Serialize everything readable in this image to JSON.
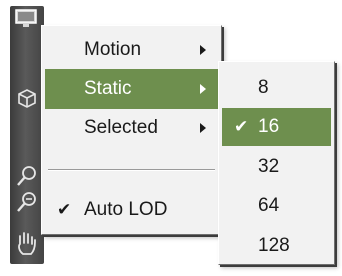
{
  "toolbar": {
    "icons": [
      "monitor-icon",
      "cube-icon",
      "zoom-icon",
      "zoom-out-icon",
      "pan-hand-icon"
    ]
  },
  "main_menu": {
    "items": [
      {
        "label": "Motion",
        "has_submenu": true,
        "checked": false,
        "highlighted": false
      },
      {
        "label": "Static",
        "has_submenu": true,
        "checked": false,
        "highlighted": true
      },
      {
        "label": "Selected",
        "has_submenu": true,
        "checked": false,
        "highlighted": false
      },
      {
        "label": "Auto LOD",
        "has_submenu": false,
        "checked": true,
        "highlighted": false
      }
    ],
    "check_mark": "✔"
  },
  "sub_menu": {
    "items": [
      {
        "label": "8",
        "checked": false,
        "highlighted": false
      },
      {
        "label": "16",
        "checked": true,
        "highlighted": true
      },
      {
        "label": "32",
        "checked": false,
        "highlighted": false
      },
      {
        "label": "64",
        "checked": false,
        "highlighted": false
      },
      {
        "label": "128",
        "checked": false,
        "highlighted": false
      }
    ],
    "check_mark": "✔"
  },
  "colors": {
    "highlight": "#6e8f4e",
    "menu_bg": "#f2f2f2",
    "toolbar_bg": "#4a4a4a"
  }
}
